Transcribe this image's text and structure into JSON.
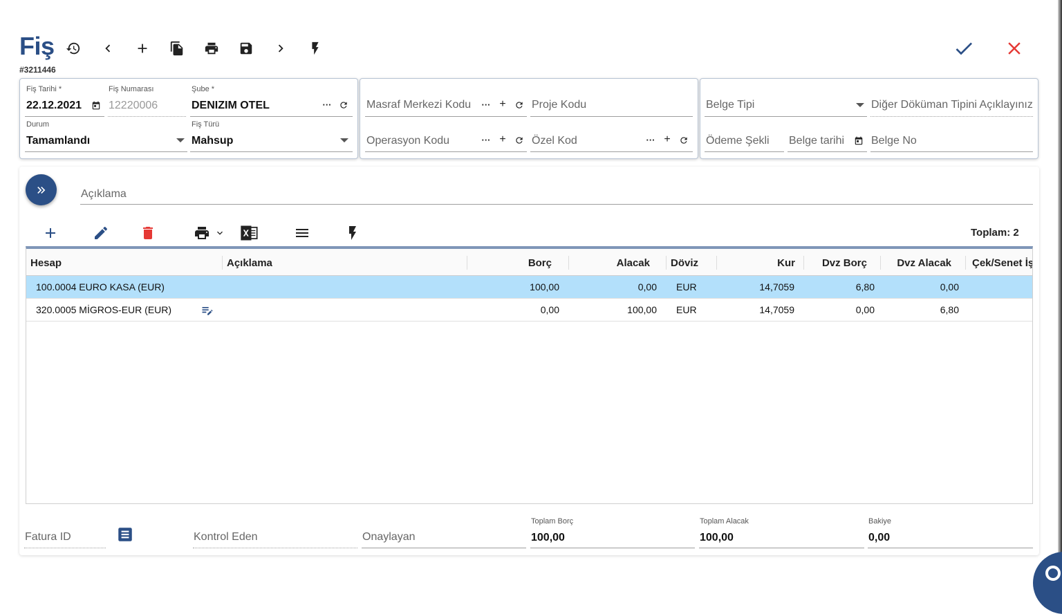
{
  "header": {
    "title": "Fiş",
    "record_id": "#3211446"
  },
  "toolbar": {
    "icons": [
      "history-icon",
      "chevron-left-icon",
      "add-icon",
      "copy-icon",
      "print-icon",
      "save-icon",
      "chevron-right-icon",
      "flash-icon"
    ],
    "confirm_icon": "check-icon",
    "close_icon": "close-icon"
  },
  "panel1": {
    "fis_tarihi_label": "Fiş Tarihi *",
    "fis_tarihi_value": "22.12.2021",
    "fis_numarasi_label": "Fiş Numarası",
    "fis_numarasi_value": "12220006",
    "sube_label": "Şube *",
    "sube_value": "DENIZIM OTEL",
    "durum_label": "Durum",
    "durum_value": "Tamamlandı",
    "fis_turu_label": "Fiş Türü",
    "fis_turu_value": "Mahsup"
  },
  "panel2": {
    "masraf_merkezi": "Masraf Merkezi Kodu",
    "proje_kodu": "Proje Kodu",
    "operasyon_kodu": "Operasyon Kodu",
    "ozel_kod": "Özel Kod",
    "dots": "···",
    "plus": "+"
  },
  "panel3": {
    "belge_tipi": "Belge Tipi",
    "diger_dokuman": "Diğer Döküman Tipini Açıklayınız",
    "odeme_sekli": "Ödeme Şekli",
    "belge_tarihi": "Belge tarihi",
    "belge_no": "Belge No"
  },
  "detail": {
    "aciklama_placeholder": "Açıklama",
    "toplam": "Toplam: 2"
  },
  "grid": {
    "columns": [
      "Hesap",
      "Açıklama",
      "Borç",
      "Alacak",
      "Döviz",
      "Kur",
      "Dvz Borç",
      "Dvz Alacak",
      "Çek/Senet İş"
    ],
    "rows": [
      {
        "hesap": "100.0004 EURO KASA (EUR)",
        "aciklama": "",
        "borc": "100,00",
        "alacak": "0,00",
        "doviz": "EUR",
        "kur": "14,7059",
        "dvz_borc": "6,80",
        "dvz_alacak": "0,00",
        "selected": true
      },
      {
        "hesap": "320.0005 MİGROS-EUR (EUR)",
        "aciklama": "",
        "borc": "0,00",
        "alacak": "100,00",
        "doviz": "EUR",
        "kur": "14,7059",
        "dvz_borc": "0,00",
        "dvz_alacak": "6,80",
        "selected": false
      }
    ]
  },
  "footer": {
    "fatura_id": "Fatura ID",
    "kontrol_eden": "Kontrol Eden",
    "onaylayan": "Onaylayan",
    "toplam_borc_label": "Toplam Borç",
    "toplam_borc_value": "100,00",
    "toplam_alacak_label": "Toplam Alacak",
    "toplam_alacak_value": "100,00",
    "bakiye_label": "Bakiye",
    "bakiye_value": "0,00"
  },
  "colors": {
    "primary": "#2b4f86",
    "danger": "#e53935",
    "selected_row": "#b3e0fb"
  }
}
